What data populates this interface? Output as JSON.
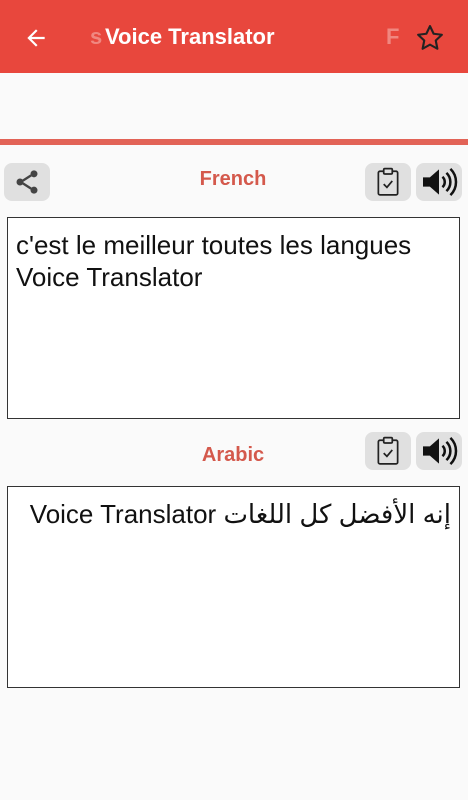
{
  "app": {
    "title": "Voice Translator",
    "ghost_left": "s",
    "ghost_right": "F",
    "icons": {
      "back": "arrow-left-icon",
      "favorite": "star-outline-icon"
    }
  },
  "source": {
    "language": "French",
    "text": "c'est le meilleur toutes les langues Voice Translator",
    "icons": [
      "share-icon",
      "clipboard-check-icon",
      "speaker-icon"
    ]
  },
  "target": {
    "language": "Arabic",
    "text": "إنه الأفضل كل اللغات Voice Translator",
    "icons": [
      "clipboard-check-icon",
      "speaker-icon"
    ]
  },
  "colors": {
    "appbar": "#e8473d",
    "accent_text": "#d4594c",
    "divider": "#e26357",
    "button_bg": "#e0e0e0"
  }
}
